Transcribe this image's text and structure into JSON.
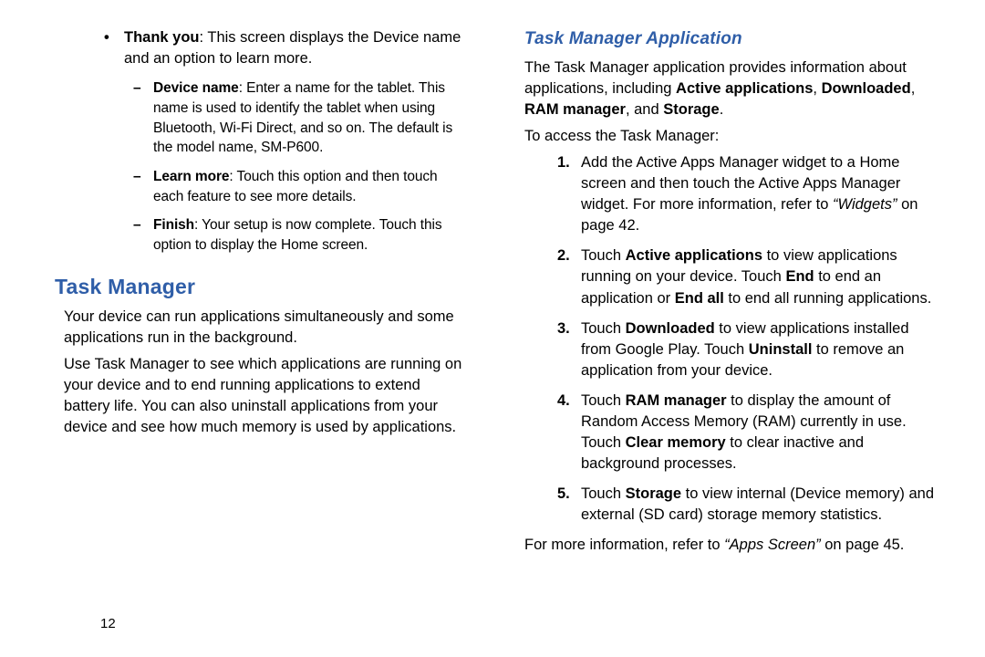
{
  "pageNumber": "12",
  "left": {
    "bullets": [
      {
        "lead": "Thank you",
        "rest": ": This screen displays the Device name and an option to learn more."
      }
    ],
    "subdash": [
      {
        "lead": "Device name",
        "rest": ": Enter a name for the tablet. This name is used to identify the tablet when using Bluetooth, Wi-Fi Direct, and so on. The default is the model name, SM-P600."
      },
      {
        "lead": "Learn more",
        "rest": ": Touch this option and then touch each feature to see more details."
      },
      {
        "lead": "Finish",
        "rest": ": Your setup is now complete. Touch this option to display the Home screen."
      }
    ],
    "h1": "Task Manager",
    "para1": "Your device can run applications simultaneously and some applications run in the background.",
    "para2": "Use Task Manager to see which applications are running on your device and to end running applications to extend battery life. You can also uninstall applications from your device and see how much memory is used by applications."
  },
  "right": {
    "h2": "Task Manager Application",
    "intro": {
      "pre": "The Task Manager application provides information about applications, including ",
      "b1": "Active applications",
      "s1": ", ",
      "b2": "Downloaded",
      "s2": ", ",
      "b3": "RAM manager",
      "s3": ", and ",
      "b4": "Storage",
      "s4": "."
    },
    "access": "To access the Task Manager:",
    "steps": [
      {
        "num": "1.",
        "pre": "Add the Active Apps Manager widget to a Home screen and then touch the Active Apps Manager widget. For more information, refer to ",
        "ref": "“Widgets”",
        "post": " on page 42."
      },
      {
        "num": "2.",
        "t1": "Touch ",
        "b1": "Active applications",
        "t2": " to view applications running on your device. Touch ",
        "b2": "End",
        "t3": " to end an application or ",
        "b3": "End all",
        "t4": " to end all running applications."
      },
      {
        "num": "3.",
        "t1": "Touch ",
        "b1": "Downloaded",
        "t2": " to view applications installed from Google Play. Touch ",
        "b2": "Uninstall",
        "t3": " to remove an application from your device."
      },
      {
        "num": "4.",
        "t1": "Touch ",
        "b1": "RAM manager",
        "t2": " to display the amount of Random Access Memory (RAM) currently in use. Touch ",
        "b2": "Clear memory",
        "t3": " to clear inactive and background processes."
      },
      {
        "num": "5.",
        "t1": "Touch ",
        "b1": "Storage",
        "t2": " to view internal (Device memory) and external (SD card) storage memory statistics."
      }
    ],
    "trail": {
      "pre": "For more information, refer to ",
      "ref": "“Apps Screen”",
      "post": " on page 45."
    }
  }
}
